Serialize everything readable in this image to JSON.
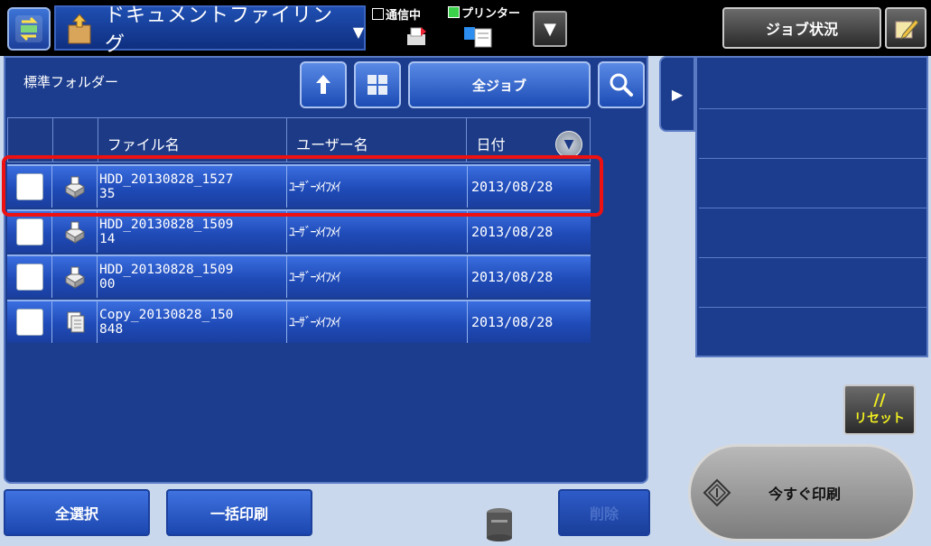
{
  "header": {
    "mode_title": "ドキュメントファイリング",
    "status_comm": "通信中",
    "status_printer": "プリンター",
    "job_status_label": "ジョブ状況"
  },
  "toolbar": {
    "folder_name": "標準フォルダー",
    "all_jobs_label": "全ジョブ"
  },
  "table": {
    "headers": [
      "ファイル名",
      "ユーザー名",
      "日付"
    ],
    "rows": [
      {
        "name": "HDD_20130828_1527\n35",
        "user": "ﾕｰｻﾞｰﾒｲﾌﾒｲ",
        "date": "2013/08/28",
        "checked": false,
        "type": "scan"
      },
      {
        "name": "HDD_20130828_1509\n14",
        "user": "ﾕｰｻﾞｰﾒｲﾌﾒｲ",
        "date": "2013/08/28",
        "checked": false,
        "type": "scan"
      },
      {
        "name": "HDD_20130828_1509\n00",
        "user": "ﾕｰｻﾞｰﾒｲﾌﾒｲ",
        "date": "2013/08/28",
        "checked": false,
        "type": "scan"
      },
      {
        "name": "Copy_20130828_150\n848",
        "user": "ﾕｰｻﾞｰﾒｲﾌﾒｲ",
        "date": "2013/08/28",
        "checked": false,
        "type": "copy"
      }
    ]
  },
  "footer": {
    "select_all_label": "全選択",
    "batch_print_label": "一括印刷",
    "delete_label": "削除"
  },
  "actions": {
    "reset_label": "リセット",
    "reset_symbol": "//",
    "print_now_label": "今すぐ印刷"
  },
  "colors": {
    "highlight": "#ee1111",
    "panel": "#1c3d8e",
    "row": "#2a5ccc",
    "reset_text": "#f0ee20"
  }
}
